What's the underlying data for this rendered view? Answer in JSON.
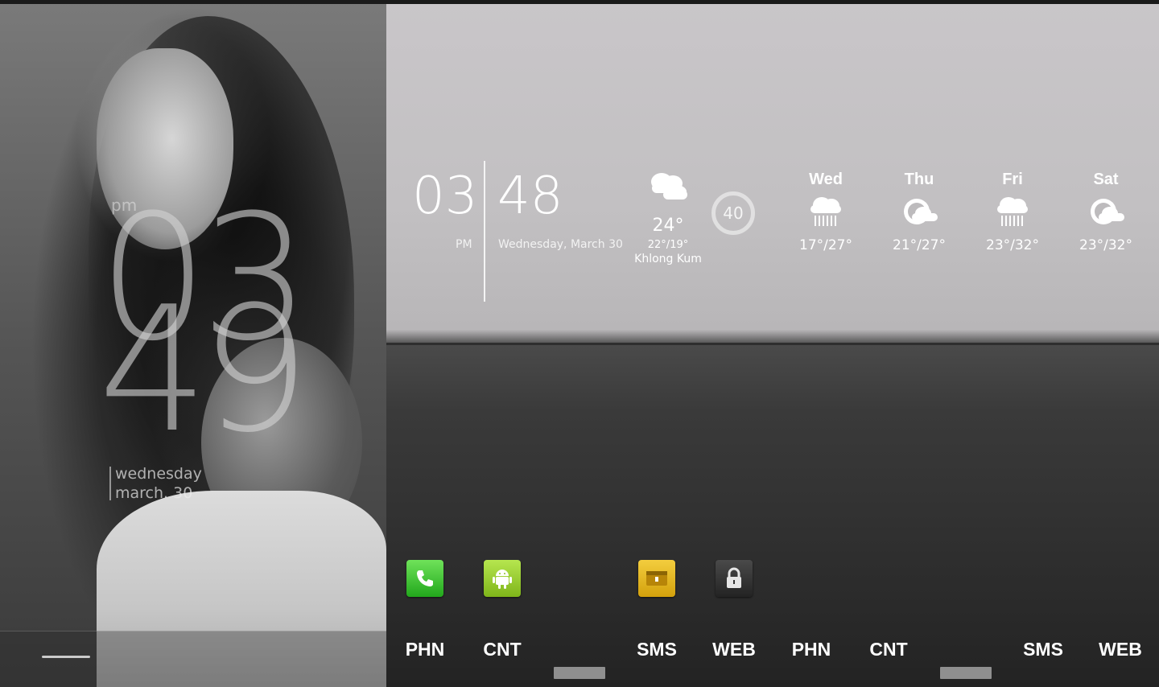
{
  "lockscreen": {
    "ampm": "pm",
    "hour": "03",
    "minute": "49",
    "weekday": "wednesday",
    "date": "march. 30"
  },
  "home": {
    "clock": {
      "hour": "03",
      "ampm": "PM",
      "minute": "48",
      "date": "Wednesday, March 30"
    },
    "weather": {
      "icon": "cloud-icon",
      "temp": "24°",
      "range": "22°/19°",
      "city": "Khlong Kum"
    },
    "battery": {
      "value": "40"
    },
    "dock": [
      {
        "label": "PHN",
        "icon": "phone-icon",
        "color": "#2fb426"
      },
      {
        "label": "CNT",
        "icon": "android-icon",
        "color": "#8cc22a"
      },
      {
        "label": "",
        "icon": "app-grid-icon"
      },
      {
        "label": "SMS",
        "icon": "mail-icon",
        "color": "#e0b221"
      },
      {
        "label": "WEB",
        "icon": "lock-icon",
        "color": "#2e2e2e"
      }
    ]
  },
  "forecast": {
    "days": [
      {
        "day": "Wed",
        "icon": "rain-cloud-icon",
        "temp": "17°/27°"
      },
      {
        "day": "Thu",
        "icon": "partly-cloudy-icon",
        "temp": "21°/27°"
      },
      {
        "day": "Fri",
        "icon": "rain-cloud-icon",
        "temp": "23°/32°"
      },
      {
        "day": "Sat",
        "icon": "partly-cloudy-icon",
        "temp": "23°/32°"
      }
    ],
    "dock_labels": [
      "PHN",
      "CNT",
      "SMS",
      "WEB"
    ]
  }
}
